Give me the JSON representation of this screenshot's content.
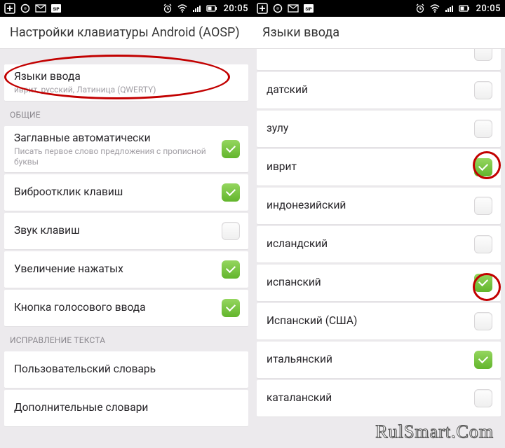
{
  "status": {
    "time": "20:05"
  },
  "left": {
    "title": "Настройки клавиатуры Android (AOSP)",
    "rows": {
      "langs_title": "Языки ввода",
      "langs_subtitle": "иврит, русский, Латиница (QWERTY)",
      "section_general": "ОБЩИЕ",
      "caps_title": "Заглавные автоматически",
      "caps_subtitle": "Писать первое слово предложения с прописной буквы",
      "vibro_title": "Виброотклик клавиш",
      "sound_title": "Звук клавиш",
      "popup_title": "Увеличение нажатых",
      "voice_title": "Кнопка голосового ввода",
      "section_textcorr": "ИСПРАВЛЕНИЕ ТЕКСТА",
      "userdict_title": "Пользовательский словарь",
      "adddict_title": "Дополнительные словари"
    }
  },
  "right": {
    "title": "Языки ввода",
    "languages": [
      {
        "label": "датский",
        "checked": false
      },
      {
        "label": "зулу",
        "checked": false
      },
      {
        "label": "иврит",
        "checked": true
      },
      {
        "label": "индонезийский",
        "checked": false
      },
      {
        "label": "исландский",
        "checked": false
      },
      {
        "label": "испанский",
        "checked": true
      },
      {
        "label": "Испанский (США)",
        "checked": false
      },
      {
        "label": "итальянский",
        "checked": true
      },
      {
        "label": "каталанский",
        "checked": false
      }
    ]
  },
  "watermark": "RulSmart.Com"
}
